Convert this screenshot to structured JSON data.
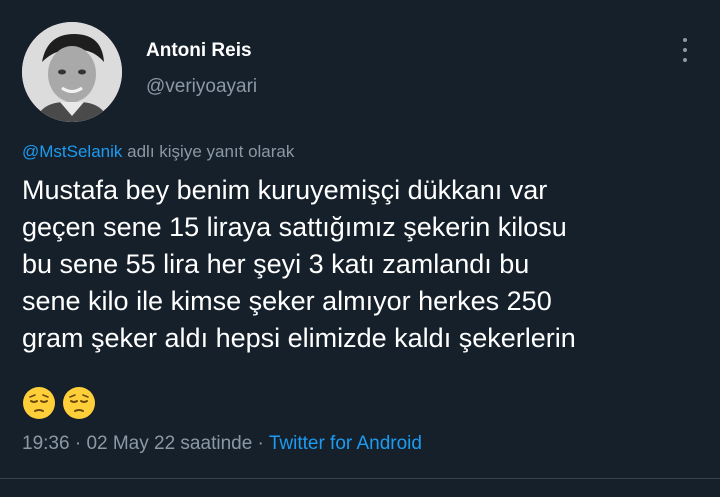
{
  "user": {
    "display_name": "Antoni Reis",
    "handle": "@veriyoayari"
  },
  "reply": {
    "mention": "@MstSelanik",
    "suffix": " adlı kişiye yanıt olarak"
  },
  "tweet": {
    "lines": [
      "Mustafa bey benim kuruyemişçi dükkanı var",
      "geçen sene 15 liraya sattığımız şekerin kilosu",
      "bu sene 55 lira her şeyi 3 katı zamlandı bu",
      "sene kilo ile kimse şeker almıyor herkes 250",
      "gram şeker aldı hepsi elimizde kaldı şekerlerin"
    ],
    "emojis": [
      "pensive-face",
      "pensive-face"
    ]
  },
  "meta": {
    "time": "19:36",
    "date": "02 May 22 saatinde",
    "separator": " · ",
    "source": "Twitter for Android"
  },
  "colors": {
    "background": "#15202b",
    "text": "#ffffff",
    "muted": "#8b98a5",
    "link": "#1d9bf0"
  }
}
